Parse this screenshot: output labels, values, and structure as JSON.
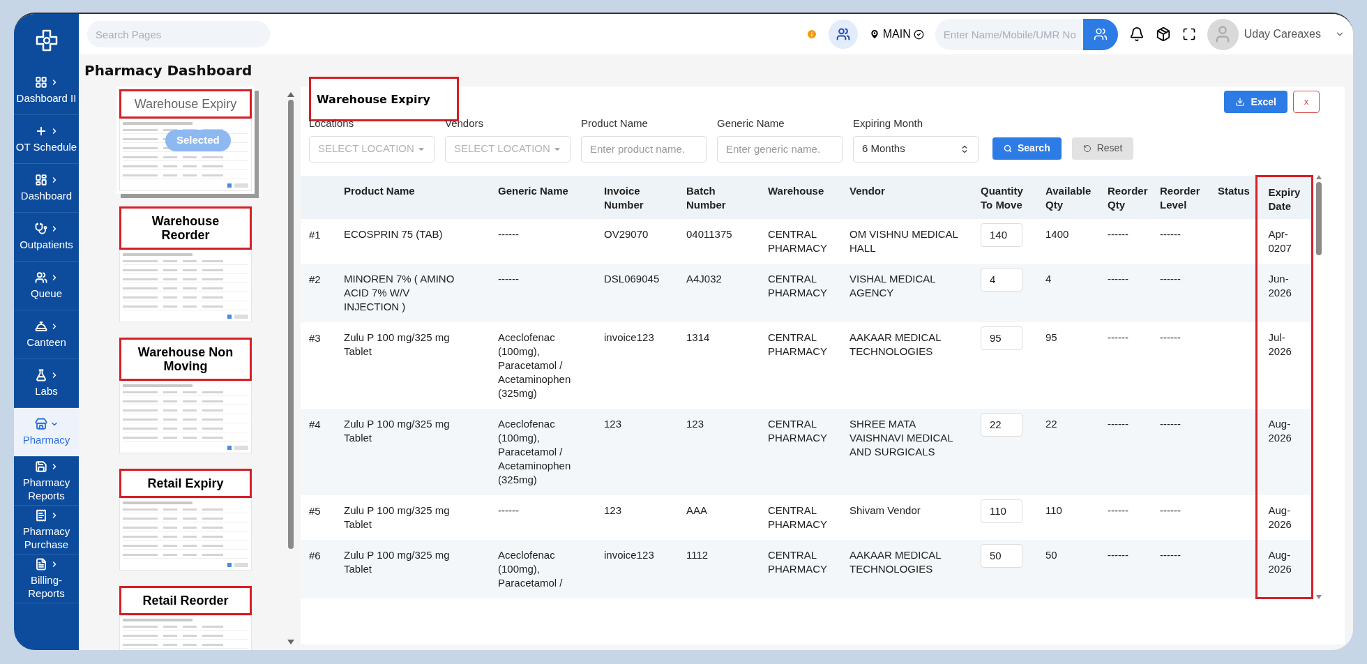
{
  "sidebar": {
    "items": [
      {
        "label": "Dashboard II",
        "selected": false
      },
      {
        "label": "OT Schedule",
        "selected": false
      },
      {
        "label": "Dashboard",
        "selected": false
      },
      {
        "label": "Outpatients",
        "selected": false
      },
      {
        "label": "Queue",
        "selected": false
      },
      {
        "label": "Canteen",
        "selected": false
      },
      {
        "label": "Labs",
        "selected": false
      },
      {
        "label": "Pharmacy",
        "selected": true
      },
      {
        "label": "Pharmacy Reports",
        "selected": false
      },
      {
        "label": "Pharmacy Purchase",
        "selected": false
      },
      {
        "label": "Billing-Reports",
        "selected": false
      }
    ]
  },
  "topbar": {
    "search": {
      "placeholder": "Search Pages"
    },
    "location": "MAIN",
    "patient_search": {
      "placeholder": "Enter Name/Mobile/UMR No"
    },
    "user": "Uday Careaxes"
  },
  "page_title": "Pharmacy Dashboard",
  "reports": {
    "selected_badge": "Selected",
    "items": [
      {
        "title": "Warehouse Expiry",
        "selected": true
      },
      {
        "title": "Warehouse Reorder",
        "selected": false
      },
      {
        "title": "Warehouse Non Moving",
        "selected": false
      },
      {
        "title": "Retail Expiry",
        "selected": false
      },
      {
        "title": "Retail Reorder",
        "selected": false
      }
    ]
  },
  "panel": {
    "title": "Warehouse Expiry",
    "excel_button": "Excel",
    "close_button": "x",
    "search_button": "Search",
    "reset_button": "Reset",
    "filters": [
      {
        "kind": "select",
        "label": "Locations",
        "placeholder": "SELECT LOCATION"
      },
      {
        "kind": "select",
        "label": "Vendors",
        "placeholder": "SELECT LOCATION"
      },
      {
        "kind": "input",
        "label": "Product Name",
        "placeholder": "Enter product name."
      },
      {
        "kind": "input",
        "label": "Generic Name",
        "placeholder": "Enter generic name."
      },
      {
        "kind": "native_select",
        "label": "Expiring Month",
        "value": "6 Months"
      }
    ]
  },
  "table": {
    "columns": [
      "Product Name",
      "Generic Name",
      "Invoice Number",
      "Batch Number",
      "Warehouse",
      "Vendor",
      "Quantity To Move",
      "Available Qty",
      "Reorder Qty",
      "Reorder Level",
      "Status",
      "Expiry Date"
    ],
    "rows": [
      {
        "index": "#1",
        "product": "ECOSPRIN 75 (TAB)",
        "generic": "------",
        "invoice": "OV29070",
        "batch": "04011375",
        "warehouse": "CENTRAL PHARMACY",
        "vendor": "OM VISHNU MEDICAL HALL",
        "qty_to_move": "140",
        "available": "1400",
        "reorder_qty": "------",
        "reorder_level": "------",
        "expiry": "Apr-0207"
      },
      {
        "index": "#2",
        "product": "MINOREN 7% ( AMINO ACID 7% W/V INJECTION )",
        "generic": "------",
        "invoice": "DSL069045",
        "batch": "A4J032",
        "warehouse": "CENTRAL PHARMACY",
        "vendor": "VISHAL MEDICAL AGENCY",
        "qty_to_move": "4",
        "available": "4",
        "reorder_qty": "------",
        "reorder_level": "------",
        "expiry": "Jun-2026"
      },
      {
        "index": "#3",
        "product": "Zulu P 100 mg/325 mg Tablet",
        "generic": "Aceclofenac (100mg), Paracetamol / Acetaminophen (325mg)",
        "invoice": "invoice123",
        "batch": "1314",
        "warehouse": "CENTRAL PHARMACY",
        "vendor": "AAKAAR MEDICAL TECHNOLOGIES",
        "qty_to_move": "95",
        "available": "95",
        "reorder_qty": "------",
        "reorder_level": "------",
        "expiry": "Jul-2026"
      },
      {
        "index": "#4",
        "product": "Zulu P 100 mg/325 mg Tablet",
        "generic": "Aceclofenac (100mg), Paracetamol / Acetaminophen (325mg)",
        "invoice": "123",
        "batch": "123",
        "warehouse": "CENTRAL PHARMACY",
        "vendor": "SHREE MATA VAISHNAVI MEDICAL AND SURGICALS",
        "qty_to_move": "22",
        "available": "22",
        "reorder_qty": "------",
        "reorder_level": "------",
        "expiry": "Aug-2026"
      },
      {
        "index": "#5",
        "product": "Zulu P 100 mg/325 mg Tablet",
        "generic": "------",
        "invoice": "123",
        "batch": "AAA",
        "warehouse": "CENTRAL PHARMACY",
        "vendor": "Shivam Vendor",
        "qty_to_move": "110",
        "available": "110",
        "reorder_qty": "------",
        "reorder_level": "------",
        "expiry": "Aug-2026"
      },
      {
        "index": "#6",
        "product": "Zulu P 100 mg/325 mg Tablet",
        "generic": "Aceclofenac (100mg), Paracetamol /",
        "invoice": "invoice123",
        "batch": "1112",
        "warehouse": "CENTRAL PHARMACY",
        "vendor": "AAKAAR MEDICAL TECHNOLOGIES",
        "qty_to_move": "50",
        "available": "50",
        "reorder_qty": "------",
        "reorder_level": "------",
        "expiry": "Aug-2026"
      }
    ]
  }
}
